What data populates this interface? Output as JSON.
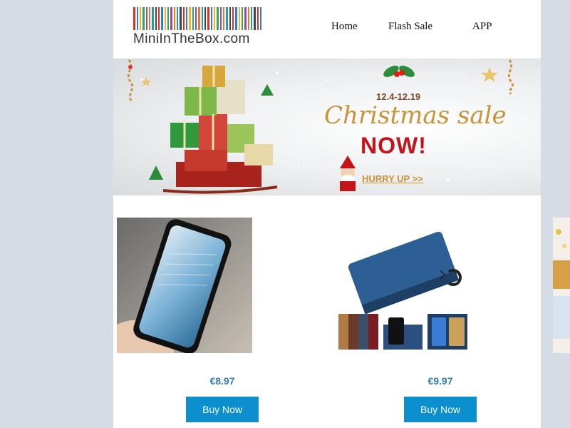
{
  "brand": {
    "logo_text": "MiniInTheBox.com"
  },
  "nav": {
    "items": [
      "Home",
      "Flash Sale",
      "APP"
    ]
  },
  "banner": {
    "dates": "12.4-12.19",
    "headline": "Christmas sale",
    "now_text": "NOW!",
    "cta": "HURRY UP >>"
  },
  "products": [
    {
      "price": "€8.97",
      "button": "Buy Now",
      "image": "magnetic-glass-phone-case"
    },
    {
      "price": "€9.97",
      "button": "Buy Now",
      "image": "leather-wallet-phone-case"
    }
  ],
  "colors": {
    "button": "#0b8fce",
    "price": "#2f80b6",
    "now": "#c3141a",
    "gold": "#c99339"
  }
}
